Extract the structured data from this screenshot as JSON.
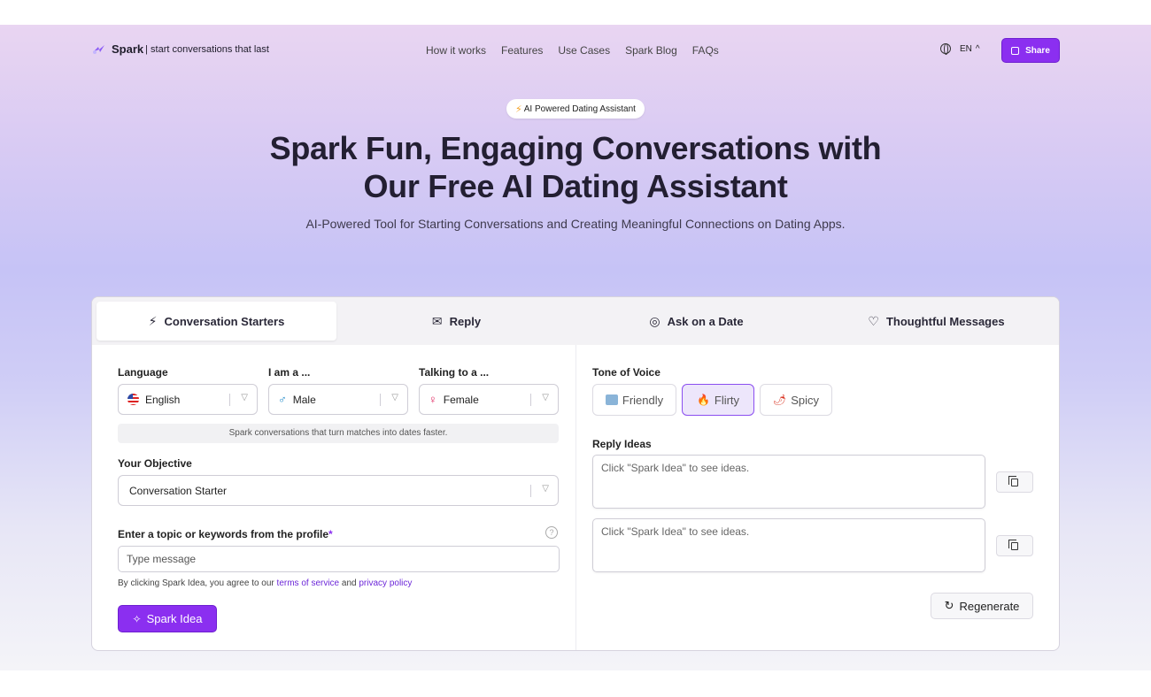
{
  "nav": {
    "brand": "Spark",
    "tagline": "| start conversations that last",
    "links": [
      "How it works",
      "Features",
      "Use Cases",
      "Spark Blog",
      "FAQs"
    ],
    "language": "EN",
    "share_label": "Share"
  },
  "hero": {
    "badge": "AI Powered Dating Assistant",
    "headline_line1": "Spark Fun, Engaging Conversations with",
    "headline_line2": "Our Free AI Dating Assistant",
    "subline": "AI-Powered Tool for Starting Conversations and Creating Meaningful Connections on Dating Apps."
  },
  "tabs": [
    {
      "label": "Conversation Starters",
      "icon": "bolt-icon"
    },
    {
      "label": "Reply",
      "icon": "reply-icon"
    },
    {
      "label": "Ask on a Date",
      "icon": "chat-icon"
    },
    {
      "label": "Thoughtful Messages",
      "icon": "hearts-icon"
    }
  ],
  "form": {
    "language_label": "Language",
    "language_value": "English",
    "iam_label": "I am a ...",
    "iam_value": "Male",
    "talking_label": "Talking to a ...",
    "talking_value": "Female",
    "note": "Spark conversations that turn matches into dates faster.",
    "objective_label": "Your Objective",
    "objective_value": "Conversation Starter",
    "topic_label": "Enter a topic or keywords from the profile",
    "required_mark": "*",
    "topic_placeholder": "Type message",
    "help": "?",
    "terms_prefix": "By clicking Spark Idea, you agree to our ",
    "terms_link": "terms of service",
    "terms_and": " and ",
    "privacy_link": "privacy policy",
    "spark_label": "Spark Idea"
  },
  "output": {
    "tone_label": "Tone of Voice",
    "tones": [
      "Friendly",
      "Flirty",
      "Spicy"
    ],
    "active_tone": "Flirty",
    "reply_label": "Reply Ideas",
    "idea_placeholder_1": "Click \"Spark Idea\" to see ideas.",
    "idea_placeholder_2": "Click \"Spark Idea\" to see ideas.",
    "regenerate_label": "Regenerate"
  },
  "colors": {
    "accent": "#8b2ff0",
    "link": "#6d28d9"
  }
}
